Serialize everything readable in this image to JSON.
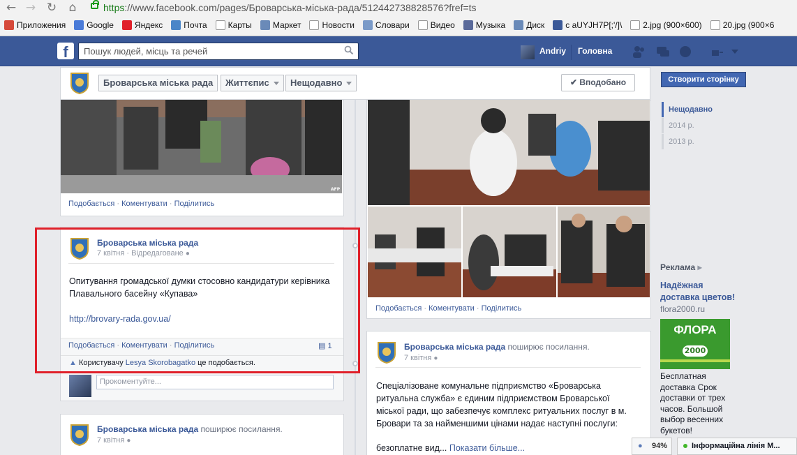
{
  "browser": {
    "url_scheme": "https",
    "url_rest": "://www.facebook.com/pages/Броварська-міська-рада/512442738828576?fref=ts",
    "bookmarks": [
      {
        "label": "Приложения",
        "icon": "apps-grid-icon",
        "color": "#d64a3a"
      },
      {
        "label": "Google",
        "icon": "google-icon",
        "color": "#4a7bd8"
      },
      {
        "label": "Яндекс",
        "icon": "yandex-icon",
        "color": "#e0202a"
      },
      {
        "label": "Почта",
        "icon": "mail-icon",
        "color": "#4a86c8"
      },
      {
        "label": "Карты",
        "icon": "page-icon",
        "color": "#ffffff"
      },
      {
        "label": "Маркет",
        "icon": "market-icon",
        "color": "#6a8ab8"
      },
      {
        "label": "Новости",
        "icon": "page-icon",
        "color": "#ffffff"
      },
      {
        "label": "Словари",
        "icon": "dictionary-icon",
        "color": "#7a9ac8"
      },
      {
        "label": "Видео",
        "icon": "page-icon",
        "color": "#ffffff"
      },
      {
        "label": "Музыка",
        "icon": "music-icon",
        "color": "#5a6a9a"
      },
      {
        "label": "Диск",
        "icon": "disk-icon",
        "color": "#6a8ab8"
      },
      {
        "label": "с aUYJH7P[;'/]\\",
        "icon": "facebook-icon",
        "color": "#3b5998"
      },
      {
        "label": "2.jpg (900×600)",
        "icon": "page-icon",
        "color": "#ffffff"
      },
      {
        "label": "20.jpg (900×6",
        "icon": "page-icon",
        "color": "#ffffff"
      }
    ]
  },
  "fb": {
    "search_placeholder": "Пошук людей, місць та речей",
    "user_name": "Andriy",
    "home_label": "Головна"
  },
  "page_header": {
    "name": "Броварська міська рада",
    "menu1": "Життєпис",
    "menu2": "Нещодавно",
    "liked_label": "Вподобано"
  },
  "left_col": {
    "top_actions": {
      "like": "Подобається",
      "comment": "Коментувати",
      "share": "Поділитись"
    },
    "top_photo_credit": "AFP",
    "post1": {
      "author": "Броварська міська рада",
      "date": "7 квітня",
      "edited": "Відредаговане",
      "text": "Опитування громадської думки стосовно кандидатури керівника Плавального басейну «Купава»",
      "link": "http://brovary-rada.gov.ua/",
      "actions": {
        "like": "Подобається",
        "comment": "Коментувати",
        "share": "Поділитись"
      },
      "comment_count": "1",
      "likes_prefix": "Користувачу",
      "likes_user": "Lesya Skorobagatko",
      "likes_suffix": "це подобається.",
      "comment_placeholder": "Прокоментуйте..."
    },
    "post2": {
      "author": "Броварська міська рада",
      "shared": "поширює посилання.",
      "date": "7 квітня"
    }
  },
  "right_col": {
    "photo_actions": {
      "like": "Подобається",
      "comment": "Коментувати",
      "share": "Поділитись"
    },
    "post": {
      "author": "Броварська міська рада",
      "shared": "поширює посилання.",
      "date": "7 квітня",
      "text": "Спеціалізоване комунальне підприємство «Броварська ритуальна служба» є єдиним підприємством Броварської міської ради, що забезпечує комплекс ритуальних послуг в м. Бровари та за найменшими цінами надає наступні послуги:",
      "more_prefix": "безоплатне вид...",
      "more_link": "Показати більше..."
    }
  },
  "sidebar": {
    "create_page": "Створити сторінку",
    "years": [
      {
        "label": "Нещодавно",
        "active": true
      },
      {
        "label": "2014 р.",
        "active": false
      },
      {
        "label": "2013 р.",
        "active": false
      }
    ],
    "ads_title": "Реклама",
    "ad_headline": "Надёжная доставка цветов!",
    "ad_url": "flora2000.ru",
    "ad_logo_top": "ФЛОРА",
    "ad_logo_num": "2000",
    "ad_text": "Бесплатная доставка Срок доставки от трех часов. Большой выбор весенних букетов!"
  },
  "status": {
    "zoom": "94%",
    "chat": "Інформаційна лінія М..."
  },
  "colors": {
    "fb_blue": "#3b5998",
    "highlight_red": "#e0202a"
  }
}
